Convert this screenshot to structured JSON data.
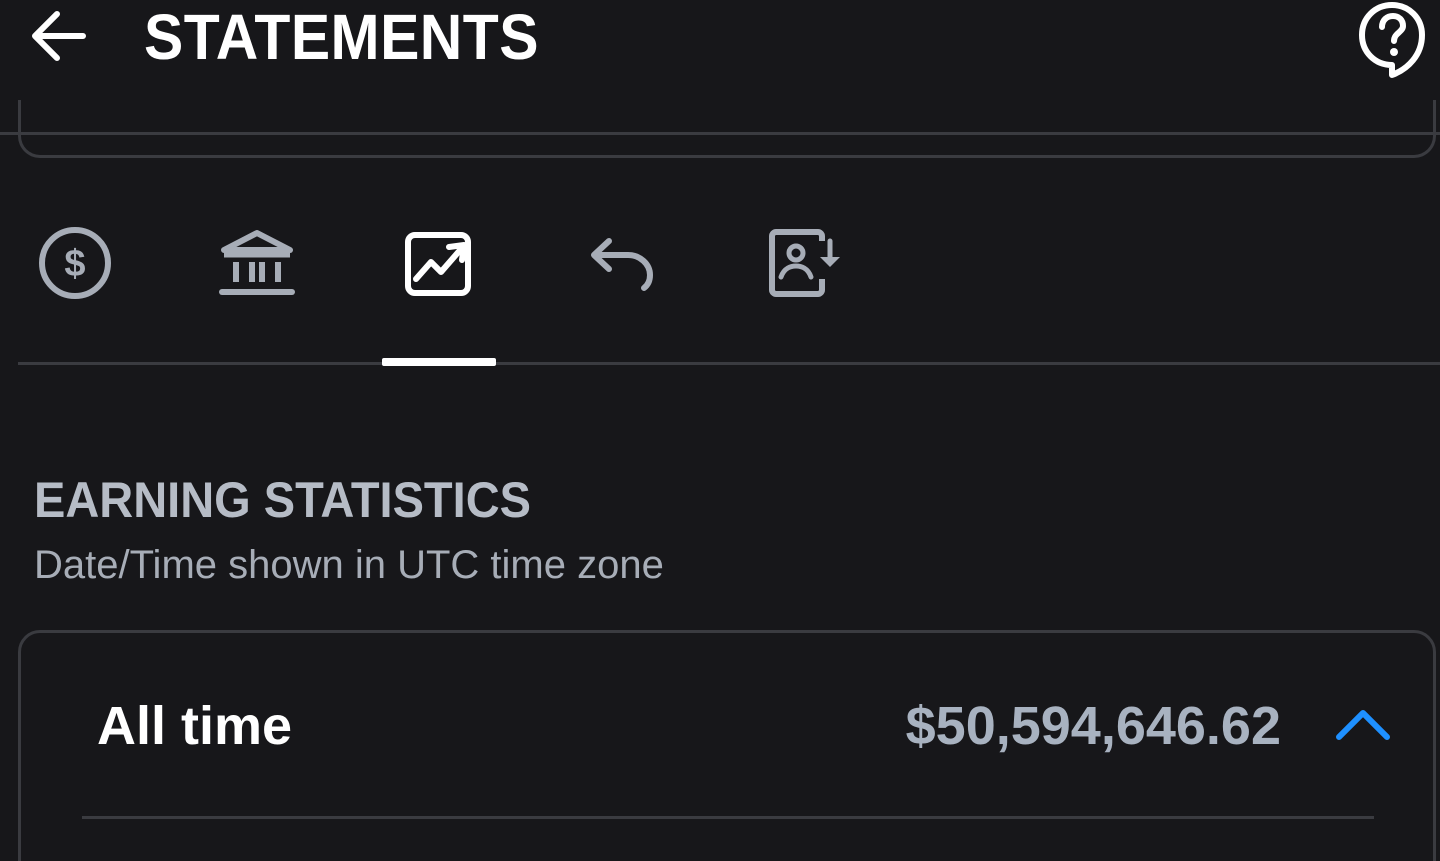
{
  "header": {
    "title": "STATEMENTS",
    "back_icon": "arrow-left-icon",
    "help_icon": "question-chat-icon"
  },
  "tabs": [
    {
      "icon": "dollar-circle-icon",
      "selected": false
    },
    {
      "icon": "bank-icon",
      "selected": false
    },
    {
      "icon": "chart-trend-icon",
      "selected": true
    },
    {
      "icon": "undo-icon",
      "selected": false
    },
    {
      "icon": "user-download-icon",
      "selected": false
    }
  ],
  "section": {
    "title": "EARNING STATISTICS",
    "subtitle": "Date/Time shown in UTC time zone"
  },
  "stats": {
    "all_time_label": "All time",
    "all_time_amount": "$50,594,646.62",
    "expanded": true
  },
  "colors": {
    "background": "#17171a",
    "divider": "#3a3b40",
    "accent": "#1e90ff",
    "muted_text": "#a8b2c0"
  }
}
